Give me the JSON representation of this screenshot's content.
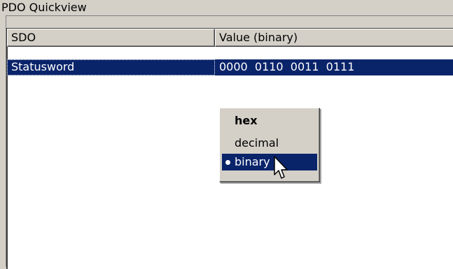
{
  "window": {
    "title": "PDO Quickview"
  },
  "table": {
    "columns": [
      "SDO",
      "Value (binary)"
    ],
    "rows": [
      {
        "sdo": "Statusword",
        "value": "0000  0110  0011  0111",
        "selected": true
      }
    ]
  },
  "context_menu": {
    "items": [
      {
        "label": "hex",
        "bold": true
      },
      {
        "label": "decimal"
      },
      {
        "label": "binary",
        "checked": true,
        "highlighted": true
      }
    ]
  },
  "colors": {
    "face": "#d4d0c8",
    "selection": "#0a246a",
    "window": "#ffffff"
  }
}
